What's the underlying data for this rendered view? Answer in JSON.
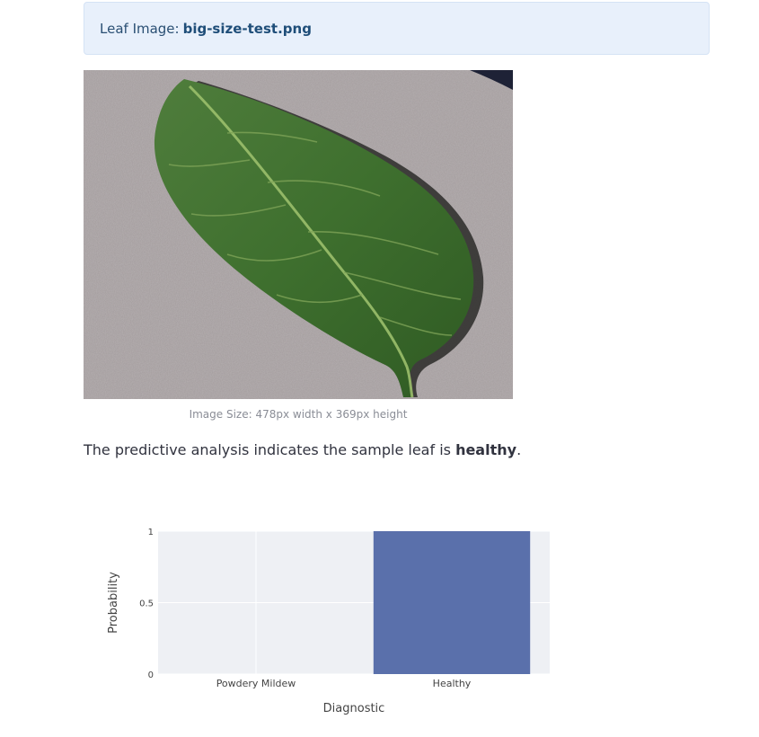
{
  "info": {
    "prefix": "Leaf Image:",
    "filename": "big-size-test.png"
  },
  "image": {
    "caption": "Image Size: 478px width x 369px height"
  },
  "analysis": {
    "text_before": "The predictive analysis indicates the sample leaf is ",
    "result": "healthy",
    "text_after": "."
  },
  "chart_data": {
    "type": "bar",
    "categories": [
      "Powdery Mildew",
      "Healthy"
    ],
    "values": [
      0,
      1
    ],
    "xlabel": "Diagnostic",
    "ylabel": "Probability",
    "ylim": [
      0,
      1
    ],
    "yticks": [
      "0",
      "0.5",
      "1"
    ],
    "grid": true,
    "colors": {
      "bar": "#5a70ab",
      "plot_bg": "#eef0f4",
      "grid": "#ffffff"
    }
  }
}
